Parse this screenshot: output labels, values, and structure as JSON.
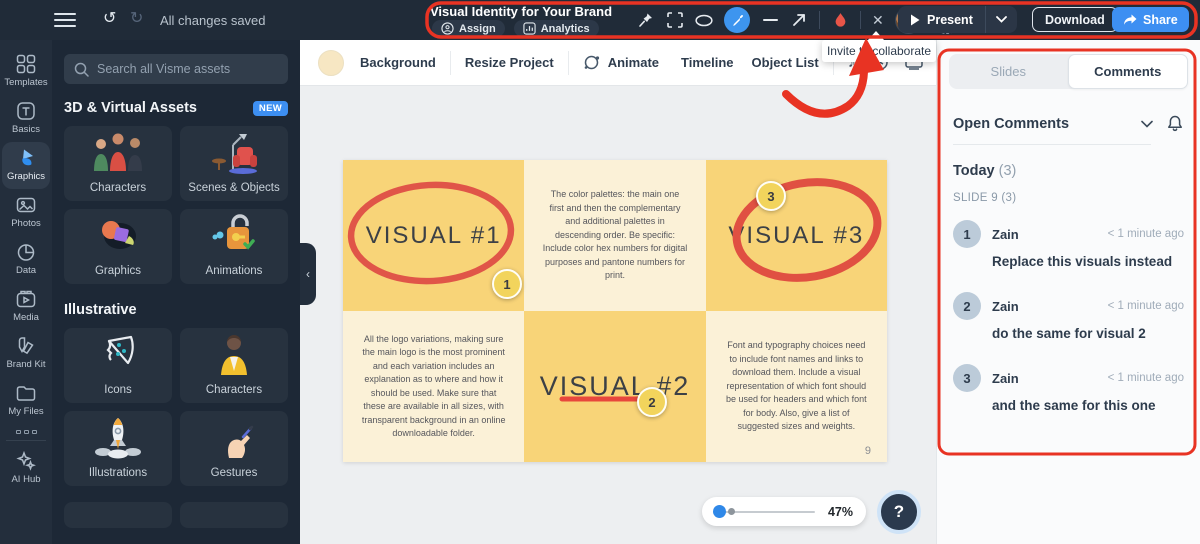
{
  "topbar": {
    "status": "All changes saved",
    "title": "Visual Identity for Your Brand",
    "assign_label": "Assign",
    "analytics_label": "Analytics",
    "present_label": "Present",
    "download_label": "Download",
    "share_label": "Share"
  },
  "icons": {
    "undo": "↺",
    "redo": "↻",
    "close": "✕",
    "plus": "+",
    "music_note": "♪",
    "chevron_left": "‹",
    "help": "?"
  },
  "tooltip": {
    "text": "Invite to collaborate"
  },
  "sidebar": {
    "items": [
      "Templates",
      "Basics",
      "Graphics",
      "Photos",
      "Data",
      "Media",
      "Brand Kit",
      "My Files",
      "AI Hub"
    ]
  },
  "assets_panel": {
    "search_placeholder": "Search all Visme assets",
    "three_d": {
      "title": "3D & Virtual Assets",
      "badge": "NEW",
      "tiles": [
        "Characters",
        "Scenes & Objects",
        "Graphics",
        "Animations"
      ]
    },
    "illustrative": {
      "title": "Illustrative",
      "tiles": [
        "Icons",
        "Characters",
        "Illustrations",
        "Gestures"
      ]
    }
  },
  "canvas_toolbar": {
    "background": "Background",
    "resize": "Resize Project",
    "animate": "Animate",
    "timeline": "Timeline",
    "object_list": "Object List"
  },
  "slide": {
    "page_number": "9",
    "pins": [
      "1",
      "2",
      "3"
    ],
    "cells": {
      "visual1": "VISUAL #1",
      "palette_text": "The color palettes: the main one first and then the complementary and additional palettes in descending order. Be specific: Include color hex numbers for digital purposes and pantone numbers for print.",
      "visual3": "VISUAL #3",
      "logo_text": "All the logo variations, making sure the main logo is the most prominent and each variation includes an explanation as to where and how it should be used. Make sure that these are available in all sizes, with transparent background in an online downloadable folder.",
      "visual2": "VISUAL #2",
      "font_text": "Font and typography choices need to include font names and links to download them. Include a visual representation of which font should be used for headers and which font for body. Also, give a list of suggested sizes and weights."
    }
  },
  "zoom_control": {
    "level": "47%"
  },
  "comments_panel": {
    "tab_slides": "Slides",
    "tab_comments": "Comments",
    "filter": "Open Comments",
    "today": "Today",
    "today_count": "(3)",
    "slide_group": "SLIDE 9 (3)",
    "items": [
      {
        "num": "1",
        "author": "Zain",
        "time": "< 1 minute ago",
        "text": "Replace this visuals instead"
      },
      {
        "num": "2",
        "author": "Zain",
        "time": "< 1 minute ago",
        "text": "do the same for visual 2"
      },
      {
        "num": "3",
        "author": "Zain",
        "time": "< 1 minute ago",
        "text": "and the same for this one"
      }
    ]
  },
  "colors": {
    "accent_blue": "#3d8ff2",
    "annotation_red": "#e83323",
    "slide_gold": "#f8d478",
    "slide_cream": "#fbf1d7",
    "topbar_navy": "#202b38"
  }
}
